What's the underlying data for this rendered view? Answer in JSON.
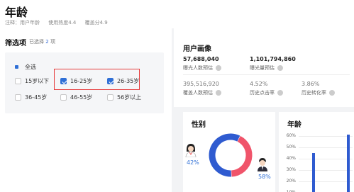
{
  "header": {
    "title": "年龄",
    "meta": [
      "注释：用户年龄",
      "使用热度4.4",
      "覆盖分4.9"
    ]
  },
  "filter": {
    "title": "筛选项",
    "selected_prefix": "已选择",
    "selected_count": "2",
    "selected_suffix": "项",
    "options": [
      {
        "label": "全选",
        "checked": false
      },
      {
        "label": "15岁以下",
        "checked": false
      },
      {
        "label": "16-25岁",
        "checked": true
      },
      {
        "label": "26-35岁",
        "checked": true
      },
      {
        "label": "36-45岁",
        "checked": false
      },
      {
        "label": "46-55岁",
        "checked": false
      },
      {
        "label": "56岁以上",
        "checked": false
      }
    ]
  },
  "portrait": {
    "title": "用户画像",
    "stats": [
      {
        "value": "57,688,040",
        "label": "曝光人数预估"
      },
      {
        "value": "1,101,794,860",
        "label": "曝光量预估"
      },
      {
        "value": "395,516,920",
        "label": "覆盖人数预估"
      },
      {
        "value": "4.52%",
        "label": "历史点击率"
      },
      {
        "value": "3.86%",
        "label": "历史转化率"
      }
    ]
  },
  "gender": {
    "title": "性别",
    "female_pct": "42%",
    "male_pct": "58%"
  },
  "age": {
    "title": "年龄",
    "yticks": [
      "60%",
      "50%",
      "40%",
      "30%",
      "20%",
      "10%"
    ]
  },
  "chart_data": {
    "type": "pie",
    "title": "性别",
    "categories": [
      "女",
      "男"
    ],
    "values": [
      42,
      58
    ],
    "colors": [
      "#f0546a",
      "#2f5bd0"
    ]
  }
}
